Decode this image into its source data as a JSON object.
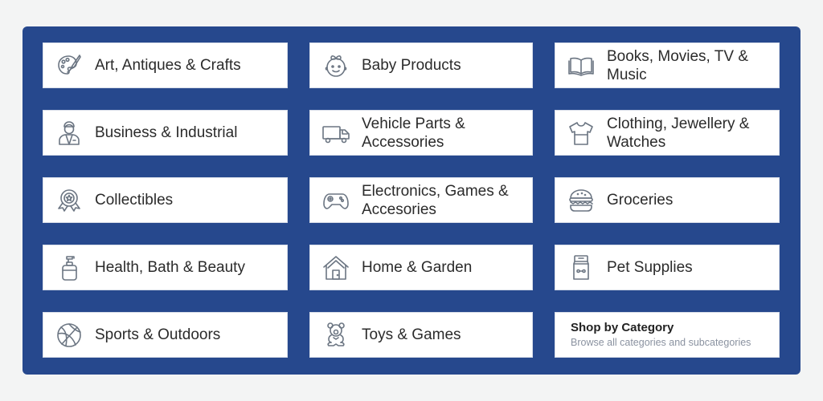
{
  "colors": {
    "panel": "#26488d",
    "background": "#f3f4f4",
    "icon": "#6b7582"
  },
  "categories": [
    {
      "label": "Art, Antiques & Crafts",
      "icon": "palette-icon"
    },
    {
      "label": "Baby Products",
      "icon": "baby-face-icon"
    },
    {
      "label": "Books, Movies, TV & Music",
      "icon": "open-book-icon"
    },
    {
      "label": "Business & Industrial",
      "icon": "worker-icon"
    },
    {
      "label": "Vehicle Parts & Accessories",
      "icon": "truck-icon"
    },
    {
      "label": "Clothing, Jewellery & Watches",
      "icon": "tshirt-icon"
    },
    {
      "label": "Collectibles",
      "icon": "badge-star-icon"
    },
    {
      "label": "Electronics, Games & Accesories",
      "icon": "gamepad-icon"
    },
    {
      "label": "Groceries",
      "icon": "burger-icon"
    },
    {
      "label": "Health, Bath & Beauty",
      "icon": "soap-dispenser-icon"
    },
    {
      "label": "Home & Garden",
      "icon": "house-icon"
    },
    {
      "label": "Pet Supplies",
      "icon": "pet-food-bag-icon"
    },
    {
      "label": "Sports & Outdoors",
      "icon": "basketball-icon"
    },
    {
      "label": "Toys & Games",
      "icon": "teddy-bear-icon"
    }
  ],
  "shop_by_category": {
    "title": "Shop by Category",
    "subtitle": "Browse all categories and subcategories"
  }
}
